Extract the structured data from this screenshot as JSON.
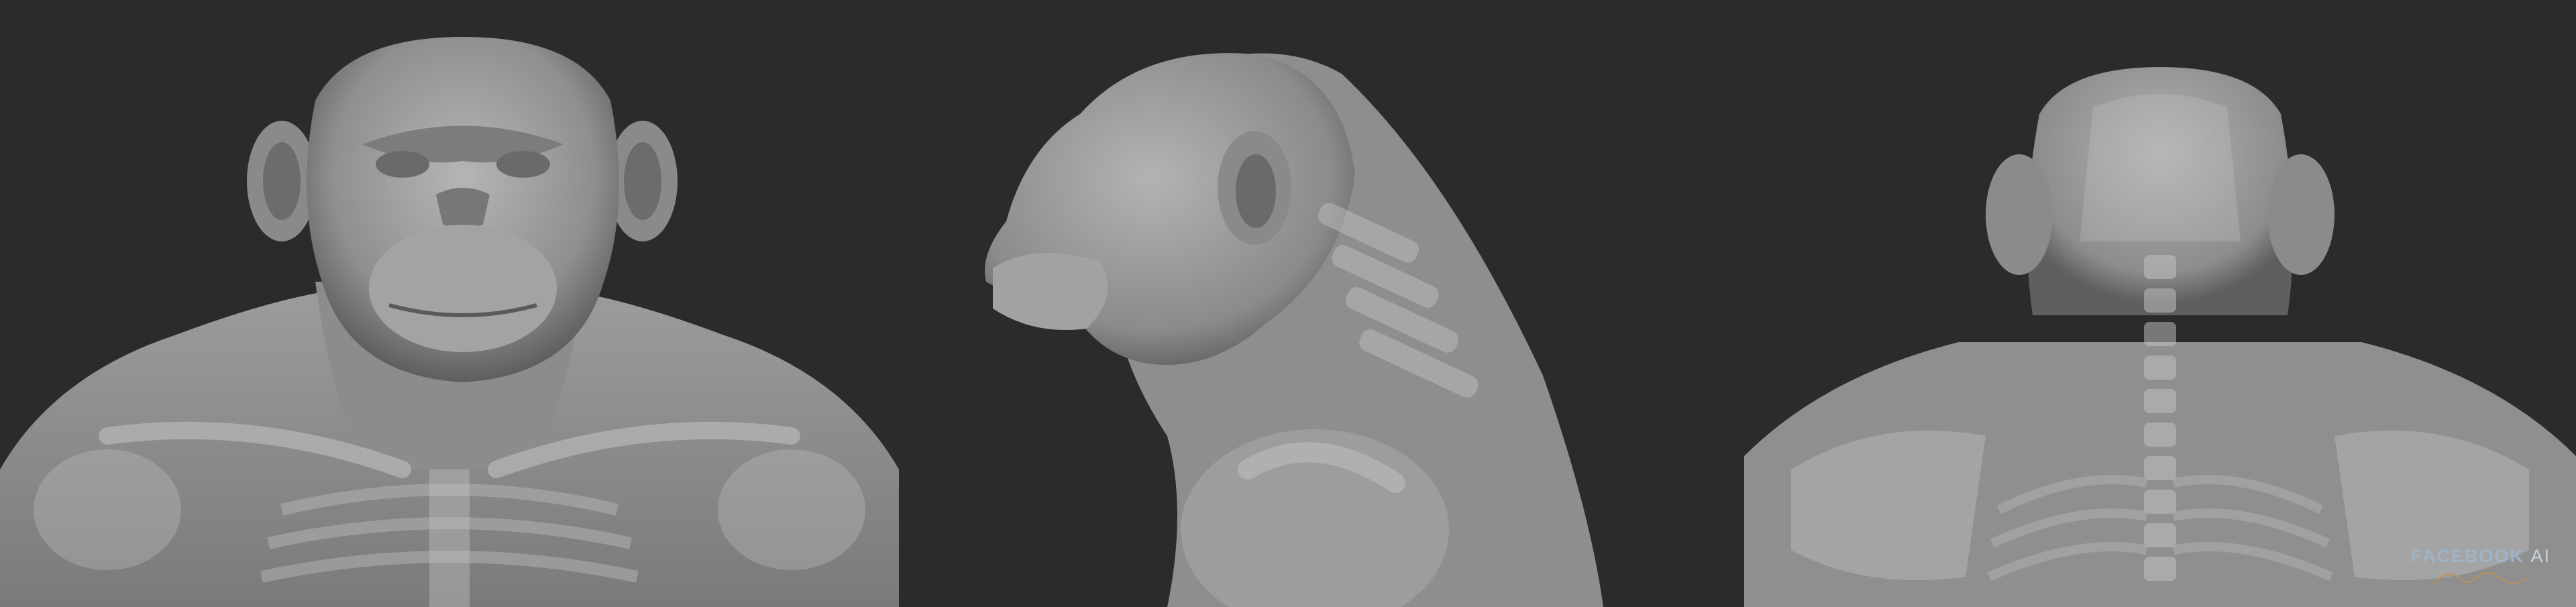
{
  "image": {
    "background_color": "#2b2b2b",
    "skin_color": "#9a9a9a",
    "skeleton_color": "#b8b8b8",
    "views": [
      "front",
      "side",
      "back"
    ]
  },
  "branding": {
    "name": "FACEBOOK",
    "suffix": "AI",
    "color": "#9fb3c8"
  }
}
